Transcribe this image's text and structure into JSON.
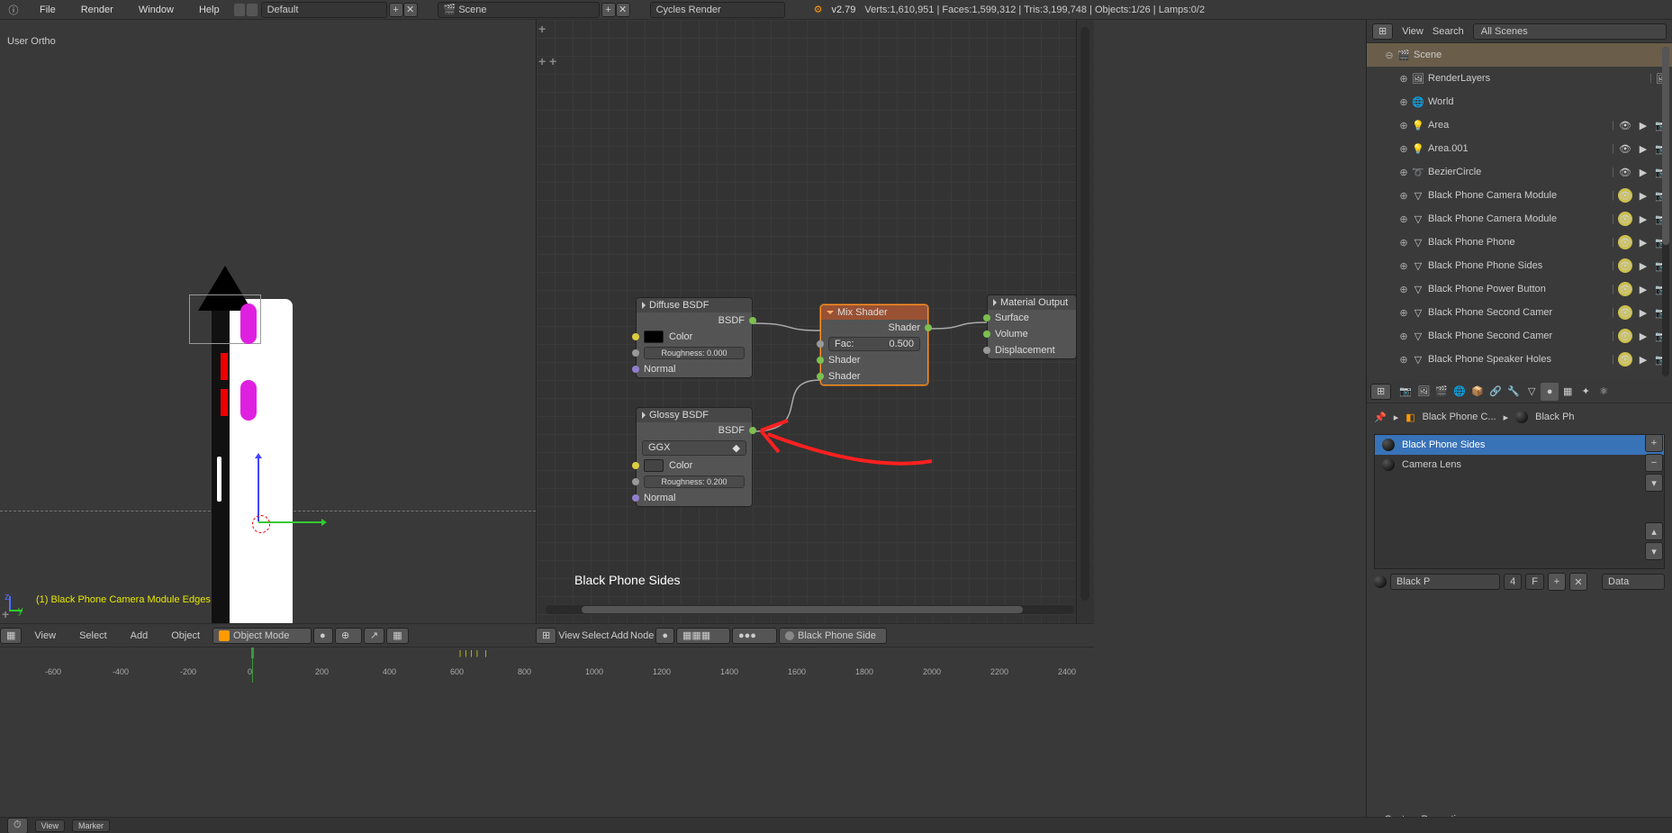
{
  "header": {
    "menus": [
      "File",
      "Render",
      "Window",
      "Help"
    ],
    "layout_dropdown": "Default",
    "scene_dropdown": "Scene",
    "engine_dropdown": "Cycles Render",
    "version": "v2.79",
    "stats": "Verts:1,610,951 | Faces:1,599,312 | Tris:3,199,748 | Objects:1/26 | Lamps:0/2"
  },
  "viewport3d": {
    "label_top": "User Ortho",
    "label_bottom": "(1) Black Phone Camera Module Edges",
    "axis_z": "z",
    "axis_y": "y",
    "footer": {
      "menus": [
        "View",
        "Select",
        "Add",
        "Object"
      ],
      "mode": "Object Mode"
    }
  },
  "node_editor": {
    "material_label": "Black Phone Sides",
    "footer": {
      "menus": [
        "View",
        "Select",
        "Add",
        "Node"
      ],
      "material_field": "Black Phone Side"
    },
    "nodes": {
      "diffuse": {
        "title": "Diffuse BSDF",
        "out_bsdf": "BSDF",
        "color_label": "Color",
        "roughness": "Roughness: 0.000",
        "normal": "Normal"
      },
      "glossy": {
        "title": "Glossy BSDF",
        "out_bsdf": "BSDF",
        "distribution": "GGX",
        "color_label": "Color",
        "roughness": "Roughness: 0.200",
        "normal": "Normal"
      },
      "mix": {
        "title": "Mix Shader",
        "out_shader": "Shader",
        "fac_label": "Fac:",
        "fac_value": "0.500",
        "shader1": "Shader",
        "shader2": "Shader"
      },
      "output": {
        "title": "Material Output",
        "surface": "Surface",
        "volume": "Volume",
        "displacement": "Displacement"
      }
    }
  },
  "outliner": {
    "menu_view": "View",
    "menu_search": "Search",
    "filter": "All Scenes",
    "tree": [
      {
        "name": "Scene",
        "icon": "scene",
        "depth": 0,
        "sel": true
      },
      {
        "name": "RenderLayers",
        "icon": "renderlayers",
        "depth": 1
      },
      {
        "name": "World",
        "icon": "world",
        "depth": 1
      },
      {
        "name": "Area",
        "icon": "lamp",
        "depth": 1,
        "eye": true
      },
      {
        "name": "Area.001",
        "icon": "lamp",
        "depth": 1,
        "eye": true
      },
      {
        "name": "BezierCircle",
        "icon": "curve",
        "depth": 1,
        "eye": true
      },
      {
        "name": "Black Phone Camera Module",
        "icon": "mesh",
        "depth": 1,
        "eye": true,
        "hl": true
      },
      {
        "name": "Black Phone Camera Module",
        "icon": "mesh",
        "depth": 1,
        "eye": true,
        "hl": true
      },
      {
        "name": "Black Phone Phone",
        "icon": "mesh",
        "depth": 1,
        "eye": true,
        "hl": true
      },
      {
        "name": "Black Phone Phone Sides",
        "icon": "mesh",
        "depth": 1,
        "eye": true,
        "hl": true
      },
      {
        "name": "Black Phone Power Button",
        "icon": "mesh",
        "depth": 1,
        "eye": true,
        "hl": true
      },
      {
        "name": "Black Phone Second Camer",
        "icon": "mesh",
        "depth": 1,
        "eye": true,
        "hl": true
      },
      {
        "name": "Black Phone Second Camer",
        "icon": "mesh",
        "depth": 1,
        "eye": true,
        "hl": true
      },
      {
        "name": "Black Phone Speaker Holes",
        "icon": "mesh",
        "depth": 1,
        "eye": true,
        "hl": true
      }
    ]
  },
  "properties": {
    "breadcrumb_obj": "Black Phone C...",
    "breadcrumb_mat": "Black Ph",
    "materials": [
      {
        "name": "Black Phone Sides",
        "sel": true
      },
      {
        "name": "Camera Lens",
        "sel": false
      }
    ],
    "mat_name_field": "Black P",
    "mat_users": "4",
    "mat_fake": "F",
    "data_dropdown": "Data",
    "custom_props": "Custom Properties"
  },
  "timeline": {
    "ticks": [
      "-600",
      "-400",
      "-200",
      "0",
      "200",
      "400",
      "600",
      "800",
      "1000",
      "1200",
      "1400",
      "1600",
      "1800",
      "2000",
      "2200",
      "2400"
    ]
  }
}
